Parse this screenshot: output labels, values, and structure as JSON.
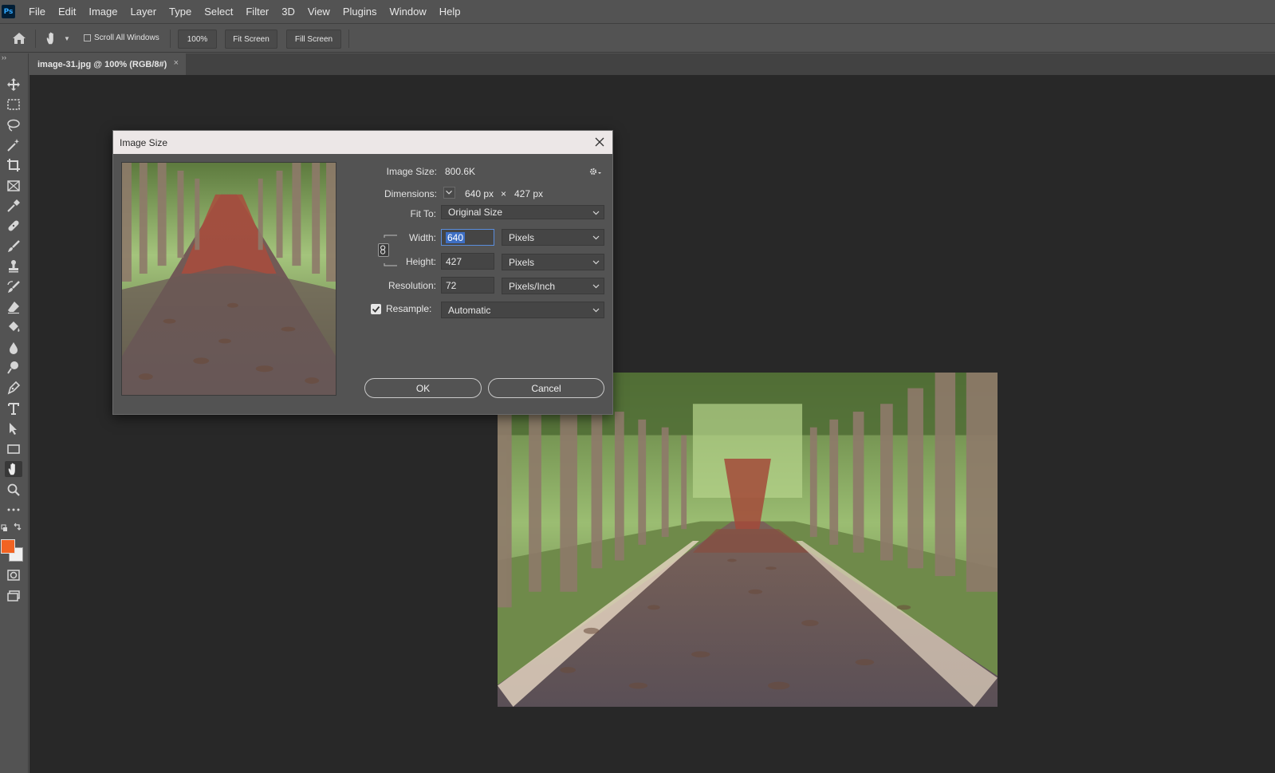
{
  "app": {
    "logo_text": "Ps"
  },
  "menu": [
    "File",
    "Edit",
    "Image",
    "Layer",
    "Type",
    "Select",
    "Filter",
    "3D",
    "View",
    "Plugins",
    "Window",
    "Help"
  ],
  "options_bar": {
    "scroll_all_windows": "Scroll All Windows",
    "zoom_btn": "100%",
    "fit_screen": "Fit Screen",
    "fill_screen": "Fill Screen"
  },
  "toolbar": {
    "collapse": "››",
    "tools": [
      "move-tool",
      "rectangular-marquee-tool",
      "lasso-tool",
      "magic-wand-tool",
      "crop-tool",
      "frame-tool",
      "eyedropper-tool",
      "spot-healing-tool",
      "brush-tool",
      "clone-stamp-tool",
      "history-brush-tool",
      "eraser-tool",
      "paint-bucket-tool",
      "blur-tool",
      "dodge-tool",
      "pen-tool",
      "type-tool",
      "path-selection-tool",
      "rectangle-tool",
      "hand-tool",
      "zoom-tool",
      "more-tools"
    ],
    "active_tool": "hand-tool",
    "foreground_color": "#f26322",
    "background_color": "#f0f0f0"
  },
  "document_tab": {
    "title": "image-31.jpg @ 100% (RGB/8#)",
    "close": "×"
  },
  "dialog": {
    "title": "Image Size",
    "image_size_label": "Image Size:",
    "image_size_value": "800.6K",
    "dimensions_label": "Dimensions:",
    "dim_width": "640 px",
    "dim_x": "×",
    "dim_height": "427 px",
    "fit_to_label": "Fit To:",
    "fit_to_value": "Original Size",
    "width_label": "Width:",
    "width_value": "640",
    "width_unit": "Pixels",
    "height_label": "Height:",
    "height_value": "427",
    "height_unit": "Pixels",
    "resolution_label": "Resolution:",
    "resolution_value": "72",
    "resolution_unit": "Pixels/Inch",
    "resample_label": "Resample:",
    "resample_checked": true,
    "resample_value": "Automatic",
    "ok": "OK",
    "cancel": "Cancel"
  }
}
